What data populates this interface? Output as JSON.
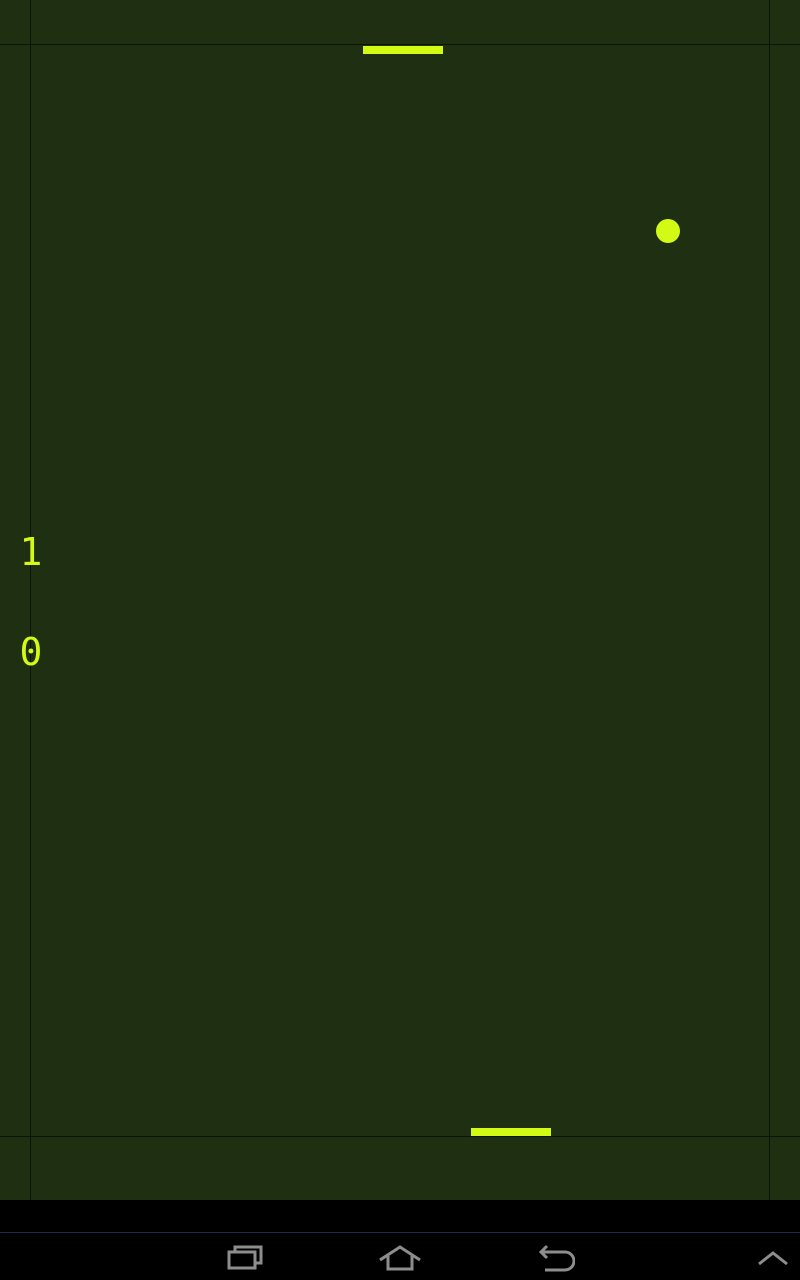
{
  "game": {
    "background_color": "#1f3012",
    "line_color": "#0b1406",
    "accent_color": "#d3fa14",
    "scores": {
      "top_player": "1",
      "bottom_player": "0"
    }
  },
  "navbar": {
    "icons": {
      "recent": "recent-apps-icon",
      "home": "home-icon",
      "back": "back-icon",
      "menu": "chevron-up-icon"
    }
  }
}
